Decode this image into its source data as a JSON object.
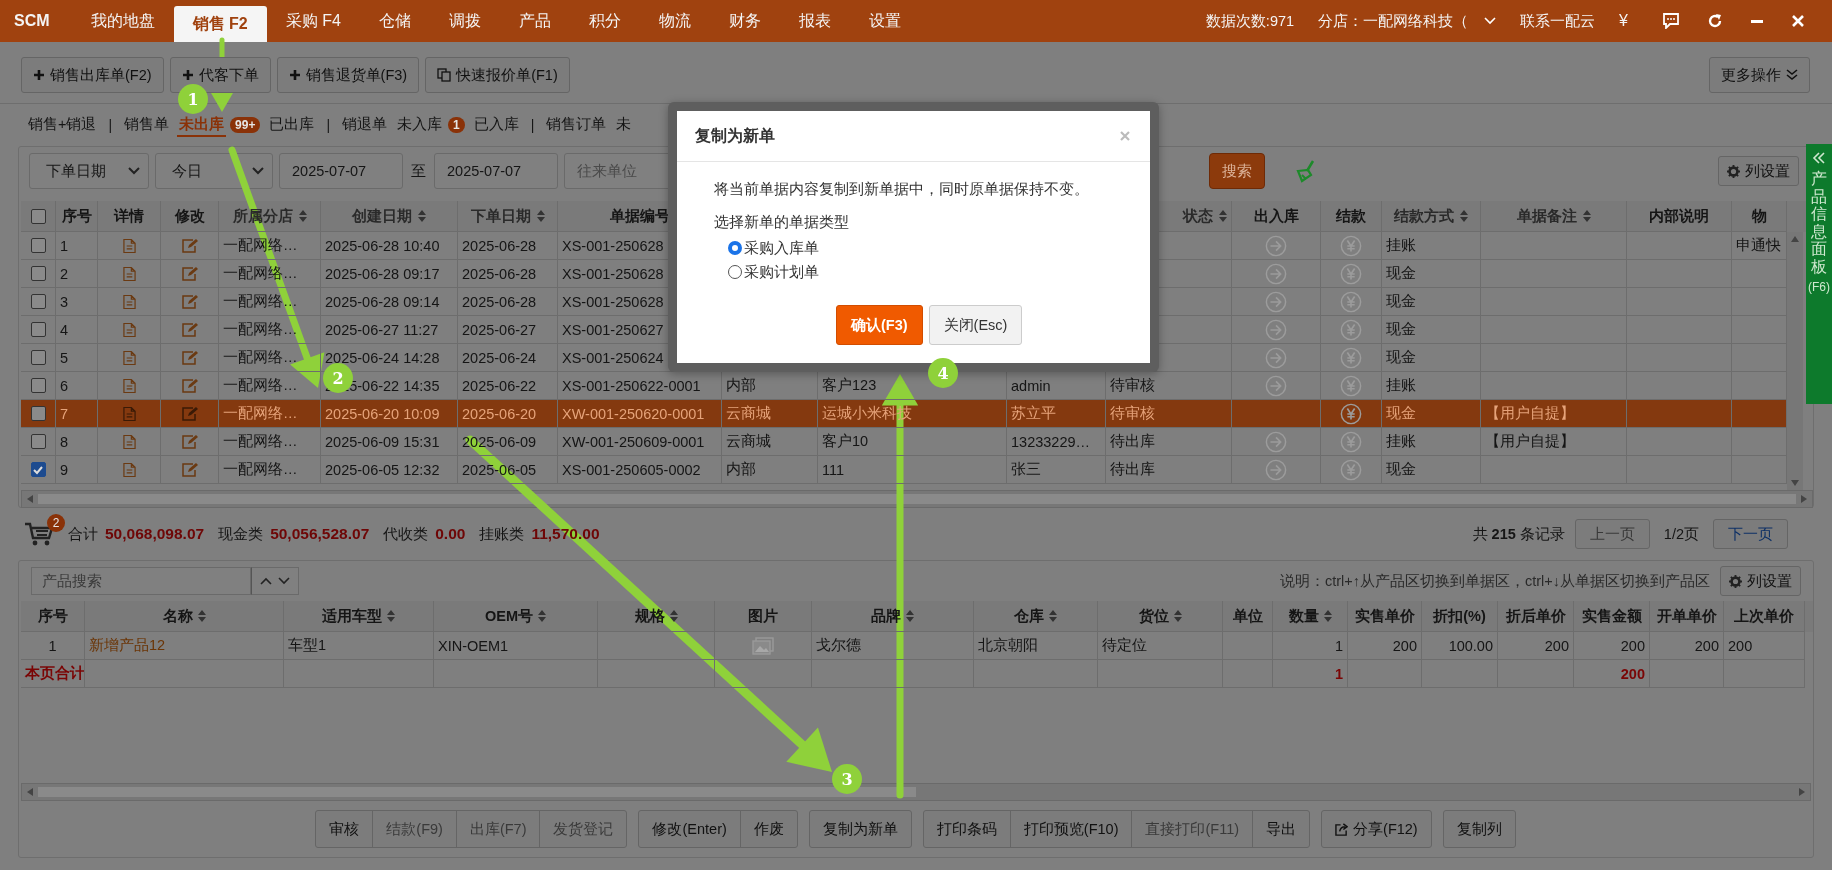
{
  "top_nav": {
    "logo": "SCM",
    "tabs": [
      {
        "label": "我的地盘",
        "selected": false
      },
      {
        "label": "销售 F2",
        "selected": true
      },
      {
        "label": "采购 F4",
        "selected": false
      },
      {
        "label": "仓储",
        "selected": false
      },
      {
        "label": "调拨",
        "selected": false
      },
      {
        "label": "产品",
        "selected": false
      },
      {
        "label": "积分",
        "selected": false
      },
      {
        "label": "物流",
        "selected": false
      },
      {
        "label": "财务",
        "selected": false
      },
      {
        "label": "报表",
        "selected": false
      },
      {
        "label": "设置",
        "selected": false
      }
    ],
    "stats": "数据次数:971",
    "branch": "分店：一配网络科技（",
    "contact": "联系一配云",
    "currency": "¥"
  },
  "toolbar": {
    "buttons": [
      {
        "label": "销售出库单(F2)",
        "kind": "add"
      },
      {
        "label": "代客下单",
        "kind": "add"
      },
      {
        "label": "销售退货单(F3)",
        "kind": "add"
      },
      {
        "label": "快速报价单(F1)",
        "kind": "quote"
      }
    ],
    "more": "更多操作"
  },
  "sub_tabs": [
    {
      "kind": "tab",
      "label": "销售+销退",
      "selected": false
    },
    {
      "kind": "separator",
      "label": "|"
    },
    {
      "kind": "tab",
      "label": "销售单",
      "selected": false
    },
    {
      "kind": "tab",
      "label": "未出库",
      "selected": true,
      "badge": "99+"
    },
    {
      "kind": "tab",
      "label": "已出库",
      "selected": false
    },
    {
      "kind": "separator",
      "label": "|"
    },
    {
      "kind": "tab",
      "label": "销退单",
      "selected": false
    },
    {
      "kind": "tab",
      "label": "未入库",
      "selected": false,
      "badge": "1"
    },
    {
      "kind": "tab",
      "label": "已入库",
      "selected": false
    },
    {
      "kind": "separator",
      "label": "|"
    },
    {
      "kind": "tab",
      "label": "销售订单",
      "selected": false
    },
    {
      "kind": "tab",
      "label": "未",
      "selected": false
    }
  ],
  "filter": {
    "date_type": "下单日期",
    "period": "今日",
    "date_from": "2025-07-07",
    "to_label": "至",
    "date_to": "2025-07-07",
    "partner_placeholder": "往来单位",
    "search_button": "搜索",
    "column_settings": "列设置"
  },
  "orders_table": {
    "header_checked": false,
    "columns": [
      {
        "label": "序号",
        "sortable": false
      },
      {
        "label": "详情",
        "sortable": false
      },
      {
        "label": "修改",
        "sortable": false
      },
      {
        "label": "所属分店",
        "sortable": true
      },
      {
        "label": "创建日期",
        "sortable": true
      },
      {
        "label": "下单日期",
        "sortable": true
      },
      {
        "label": "单据编号",
        "sortable": false
      },
      null,
      null,
      null,
      {
        "label": "状态",
        "sortable": true
      },
      {
        "label": "出入库",
        "sortable": false
      },
      {
        "label": "结款",
        "sortable": false
      },
      {
        "label": "结款方式",
        "sortable": true
      },
      {
        "label": "单据备注",
        "sortable": true
      },
      {
        "label": "内部说明",
        "sortable": false
      },
      {
        "label": "物",
        "sortable": false
      }
    ],
    "rows": [
      {
        "number": "1",
        "checked": false,
        "selected": false,
        "shop": "一配网络…",
        "created": "2025-06-28 10:40",
        "order_date": "2025-06-28",
        "doc_no": "XS-001-250628",
        "in_out_icon": true,
        "pay_method": "挂账",
        "logistics": "申通快"
      },
      {
        "number": "2",
        "checked": false,
        "selected": false,
        "shop": "一配网络…",
        "created": "2025-06-28 09:17",
        "order_date": "2025-06-28",
        "doc_no": "XS-001-250628",
        "in_out_icon": true,
        "pay_method": "现金"
      },
      {
        "number": "3",
        "checked": false,
        "selected": false,
        "shop": "一配网络…",
        "created": "2025-06-28 09:14",
        "order_date": "2025-06-28",
        "doc_no": "XS-001-250628",
        "in_out_icon": true,
        "pay_method": "现金"
      },
      {
        "number": "4",
        "checked": false,
        "selected": false,
        "shop": "一配网络…",
        "created": "2025-06-27 11:27",
        "order_date": "2025-06-27",
        "doc_no": "XS-001-250627",
        "in_out_icon": true,
        "pay_method": "现金"
      },
      {
        "number": "5",
        "checked": false,
        "selected": false,
        "shop": "一配网络…",
        "created": "2025-06-24 14:28",
        "order_date": "2025-06-24",
        "doc_no": "XS-001-250624",
        "in_out_icon": true,
        "pay_method": "现金"
      },
      {
        "number": "6",
        "checked": false,
        "selected": false,
        "shop": "一配网络…",
        "created": "2025-06-22 14:35",
        "order_date": "2025-06-22",
        "doc_no": "XS-001-250622-0001",
        "column_9": "内部",
        "column_10": "客户123",
        "column_11": "admin",
        "status": "待审核",
        "in_out_icon": true,
        "pay_method": "挂账"
      },
      {
        "number": "7",
        "checked": false,
        "selected": true,
        "shop": "一配网络…",
        "created": "2025-06-20 10:09",
        "order_date": "2025-06-20",
        "doc_no": "XW-001-250620-0001",
        "column_9": "云商城",
        "column_10": "运城小米科技",
        "column_11": "苏立平",
        "status": "待审核",
        "in_out_icon": false,
        "pay_method": "现金",
        "remark": "【用户自提】"
      },
      {
        "number": "8",
        "checked": false,
        "selected": false,
        "shop": "一配网络…",
        "created": "2025-06-09 15:31",
        "order_date": "2025-06-09",
        "doc_no": "XW-001-250609-0001",
        "column_9": "云商城",
        "column_10": "客户10",
        "column_11": "13233229…",
        "status": "待出库",
        "in_out_icon": true,
        "pay_method": "挂账",
        "remark": "【用户自提】"
      },
      {
        "number": "9",
        "checked": true,
        "selected": false,
        "shop": "一配网络…",
        "created": "2025-06-05 12:32",
        "order_date": "2025-06-05",
        "doc_no": "XS-001-250605-0002",
        "column_9": "内部",
        "column_10": "111",
        "column_11": "张三",
        "status": "待出库",
        "in_out_icon": true,
        "pay_method": "现金"
      }
    ]
  },
  "summary": {
    "cart_badge": "2",
    "totals": [
      {
        "label": "合计",
        "value": "50,068,098.07"
      },
      {
        "label": "现金类",
        "value": "50,056,528.07"
      },
      {
        "label": "代收类",
        "value": "0.00"
      },
      {
        "label": "挂账类",
        "value": "11,570.00"
      }
    ],
    "records": "共 **215** 条记录",
    "prev": {
      "label": "上一页",
      "disabled": true
    },
    "page": "1/2页",
    "next": {
      "label": "下一页",
      "disabled": false
    }
  },
  "product_search": {
    "placeholder": "产品搜索",
    "hint": "说明：ctrl+↑从产品区切换到单据区，ctrl+↓从单据区切换到产品区",
    "column_settings": "列设置"
  },
  "products_table": {
    "columns": [
      {
        "label": "序号",
        "sortable": false
      },
      {
        "label": "名称",
        "sortable": true
      },
      {
        "label": "适用车型",
        "sortable": true
      },
      {
        "label": "OEM号",
        "sortable": true
      },
      {
        "label": "规格",
        "sortable": true
      },
      {
        "label": "图片",
        "sortable": false
      },
      {
        "label": "品牌",
        "sortable": true
      },
      {
        "label": "仓库",
        "sortable": true
      },
      {
        "label": "货位",
        "sortable": true
      },
      {
        "label": "单位",
        "sortable": false
      },
      {
        "label": "数量",
        "sortable": true
      },
      {
        "label": "实售单价",
        "sortable": false
      },
      {
        "label": "折扣(%)",
        "sortable": false
      },
      {
        "label": "折后单价",
        "sortable": false
      },
      {
        "label": "实售金额",
        "sortable": false
      },
      {
        "label": "开单单价",
        "sortable": false
      },
      {
        "label": "上次单价",
        "sortable": false
      }
    ],
    "rows": [
      {
        "number": "1",
        "name": "新增产品12",
        "model": "车型1",
        "oem": "XIN-OEM1",
        "has_image": true,
        "brand": "戈尔德",
        "warehouse": "北京朝阳",
        "location": "待定位",
        "qty": "1",
        "price": "200",
        "discount": "100.00",
        "net_price": "200",
        "amount": "200",
        "list_price": "200",
        "last_price": "200"
      }
    ],
    "total": {
      "label": "本页合计",
      "qty": "1",
      "amount": "200"
    }
  },
  "actions": [
    {
      "buttons": [
        {
          "label": "审核",
          "disabled": false,
          "kind": "plain"
        },
        {
          "label": "结款(F9)",
          "disabled": true,
          "kind": "plain"
        },
        {
          "label": "出库(F7)",
          "disabled": true,
          "kind": "plain"
        },
        {
          "label": "发货登记",
          "disabled": true,
          "kind": "plain"
        }
      ]
    },
    {
      "buttons": [
        {
          "label": "修改(Enter)",
          "disabled": false,
          "kind": "plain"
        },
        {
          "label": "作废",
          "disabled": false,
          "kind": "plain"
        }
      ]
    },
    {
      "buttons": [
        {
          "label": "复制为新单",
          "disabled": false,
          "kind": "plain"
        }
      ]
    },
    {
      "buttons": [
        {
          "label": "打印条码",
          "disabled": false,
          "kind": "plain"
        },
        {
          "label": "打印预览(F10)",
          "disabled": false,
          "kind": "plain"
        },
        {
          "label": "直接打印(F11)",
          "disabled": true,
          "kind": "plain"
        },
        {
          "label": "导出",
          "disabled": false,
          "kind": "plain"
        }
      ]
    },
    {
      "buttons": [
        {
          "label": "分享(F12)",
          "disabled": false,
          "kind": "share"
        }
      ]
    },
    {
      "buttons": [
        {
          "label": "复制列",
          "disabled": false,
          "kind": "plain"
        }
      ]
    }
  ],
  "side_panel": {
    "label": "产品信息面板",
    "key": "(F6)"
  },
  "dialog": {
    "title": "复制为新单",
    "message": "将当前单据内容复制到新单据中，同时原单据保持不变。",
    "type_label": "选择新单的单据类型",
    "options": [
      {
        "label": "采购入库单",
        "selected": true
      },
      {
        "label": "采购计划单",
        "selected": false
      }
    ],
    "confirm": "确认(F3)",
    "close": "关闭(Esc)"
  },
  "annotations": [
    {
      "number": "1"
    },
    {
      "number": "2"
    },
    {
      "number": "3"
    },
    {
      "number": "4"
    }
  ]
}
